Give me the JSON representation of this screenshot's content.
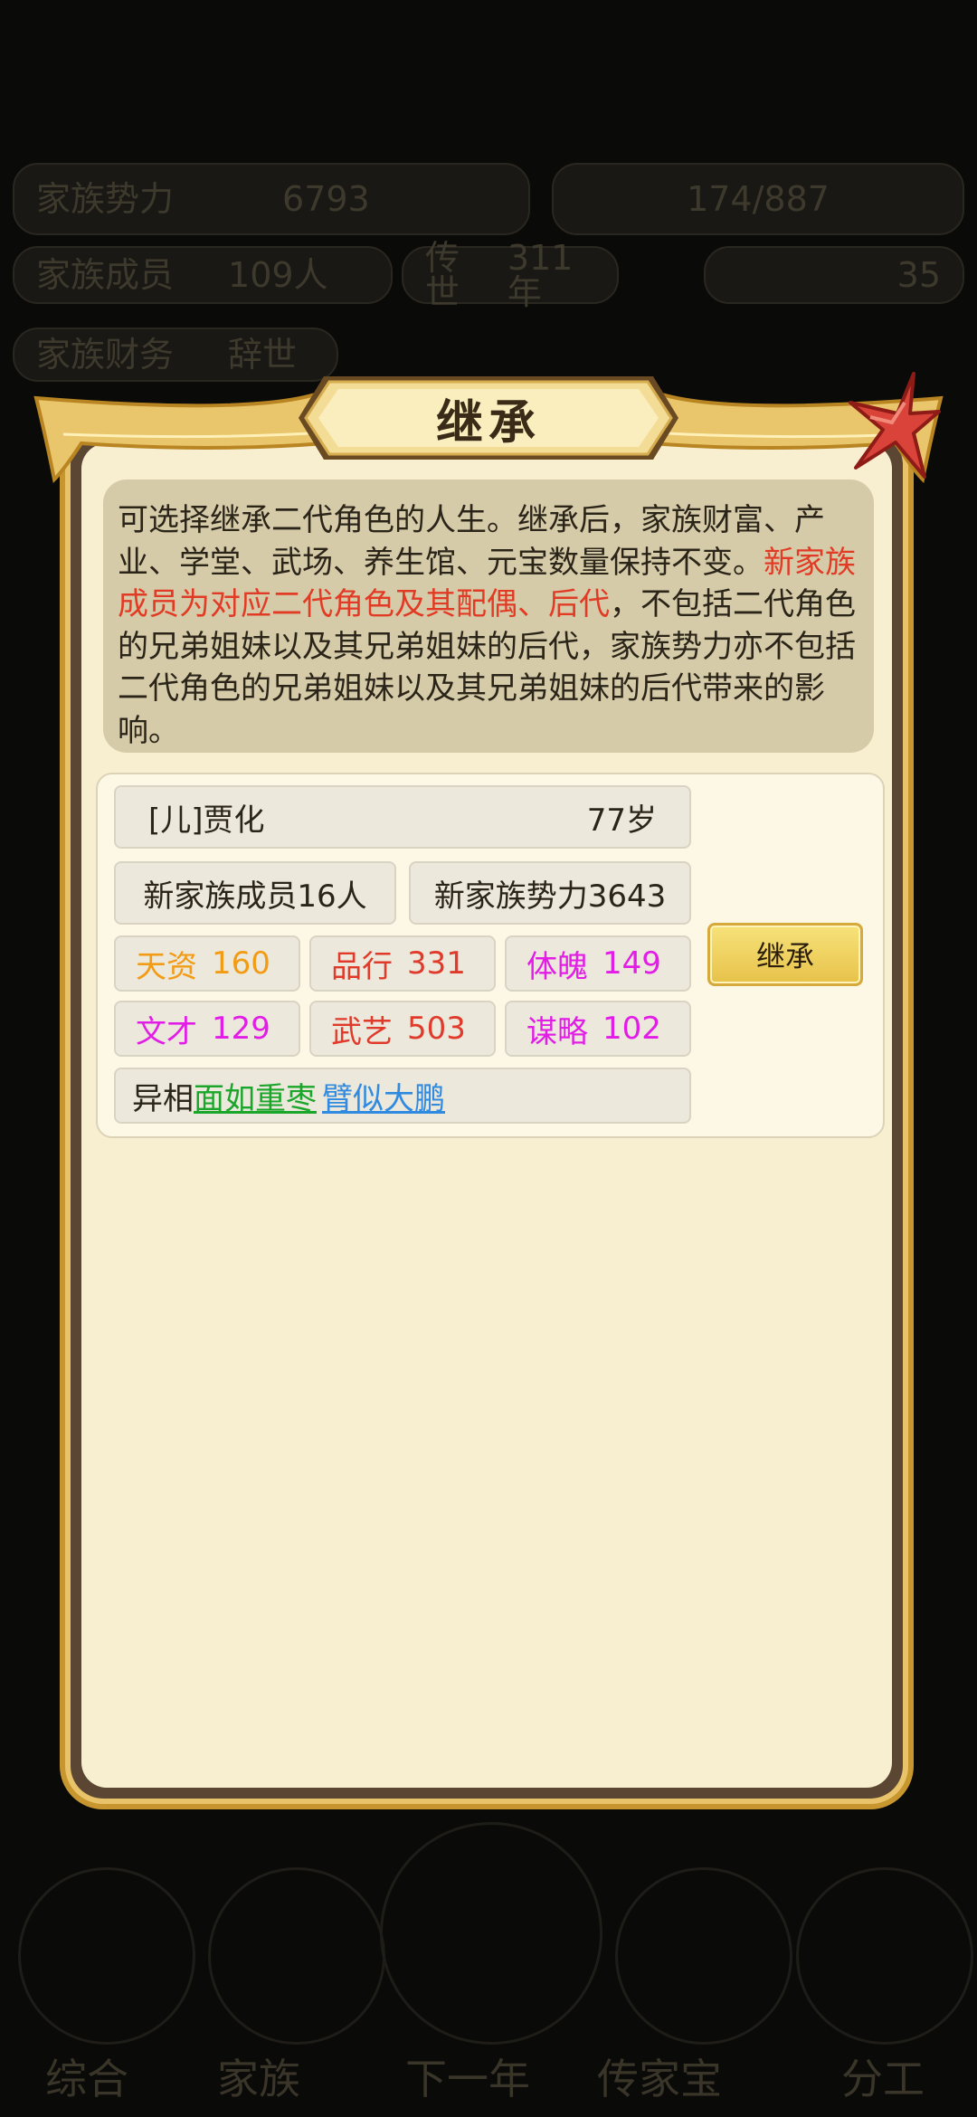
{
  "background": {
    "top_bar": {
      "power_label": "家族势力",
      "power_value": "6793",
      "resource_value": "174/887",
      "members_label": "家族成员",
      "members_value": "109人",
      "generation_label": "传世",
      "generation_value": "311年",
      "coins_value": "35",
      "row3_left": "家族财务",
      "row3_right": "辞世"
    },
    "bottom_tabs": [
      "综合",
      "家族",
      "下一年",
      "传家宝",
      "分工"
    ]
  },
  "modal": {
    "title": "继承",
    "description": {
      "part1": "可选择继承二代角色的人生。继承后，家族财富、产业、学堂、武场、养生馆、元宝数量保持不变。",
      "highlight": "新家族成员为对应二代角色及其配偶、后代",
      "part2": "，不包括二代角色的兄弟姐妹以及其兄弟姐妹的后代，家族势力亦不包括二代角色的兄弟姐妹以及其兄弟姐妹的后代带来的影响。"
    },
    "candidate": {
      "name": "[儿]贾化",
      "age": "77岁",
      "new_members": "新家族成员16人",
      "new_power": "新家族势力3643",
      "stats": [
        {
          "label": "天资",
          "value": "160",
          "color": "#f29b14"
        },
        {
          "label": "品行",
          "value": "331",
          "color": "#e03a2b"
        },
        {
          "label": "体魄",
          "value": "149",
          "color": "#e21ee6"
        },
        {
          "label": "文才",
          "value": "129",
          "color": "#e21ee6"
        },
        {
          "label": "武艺",
          "value": "503",
          "color": "#e03a2b"
        },
        {
          "label": "谋略",
          "value": "102",
          "color": "#e21ee6"
        }
      ],
      "traits_label": "异相",
      "traits": [
        {
          "text": "面如重枣",
          "color": "#1aa62a"
        },
        {
          "text": "臂似大鹏",
          "color": "#2f8ae0"
        }
      ]
    },
    "inherit_button": "继承"
  }
}
